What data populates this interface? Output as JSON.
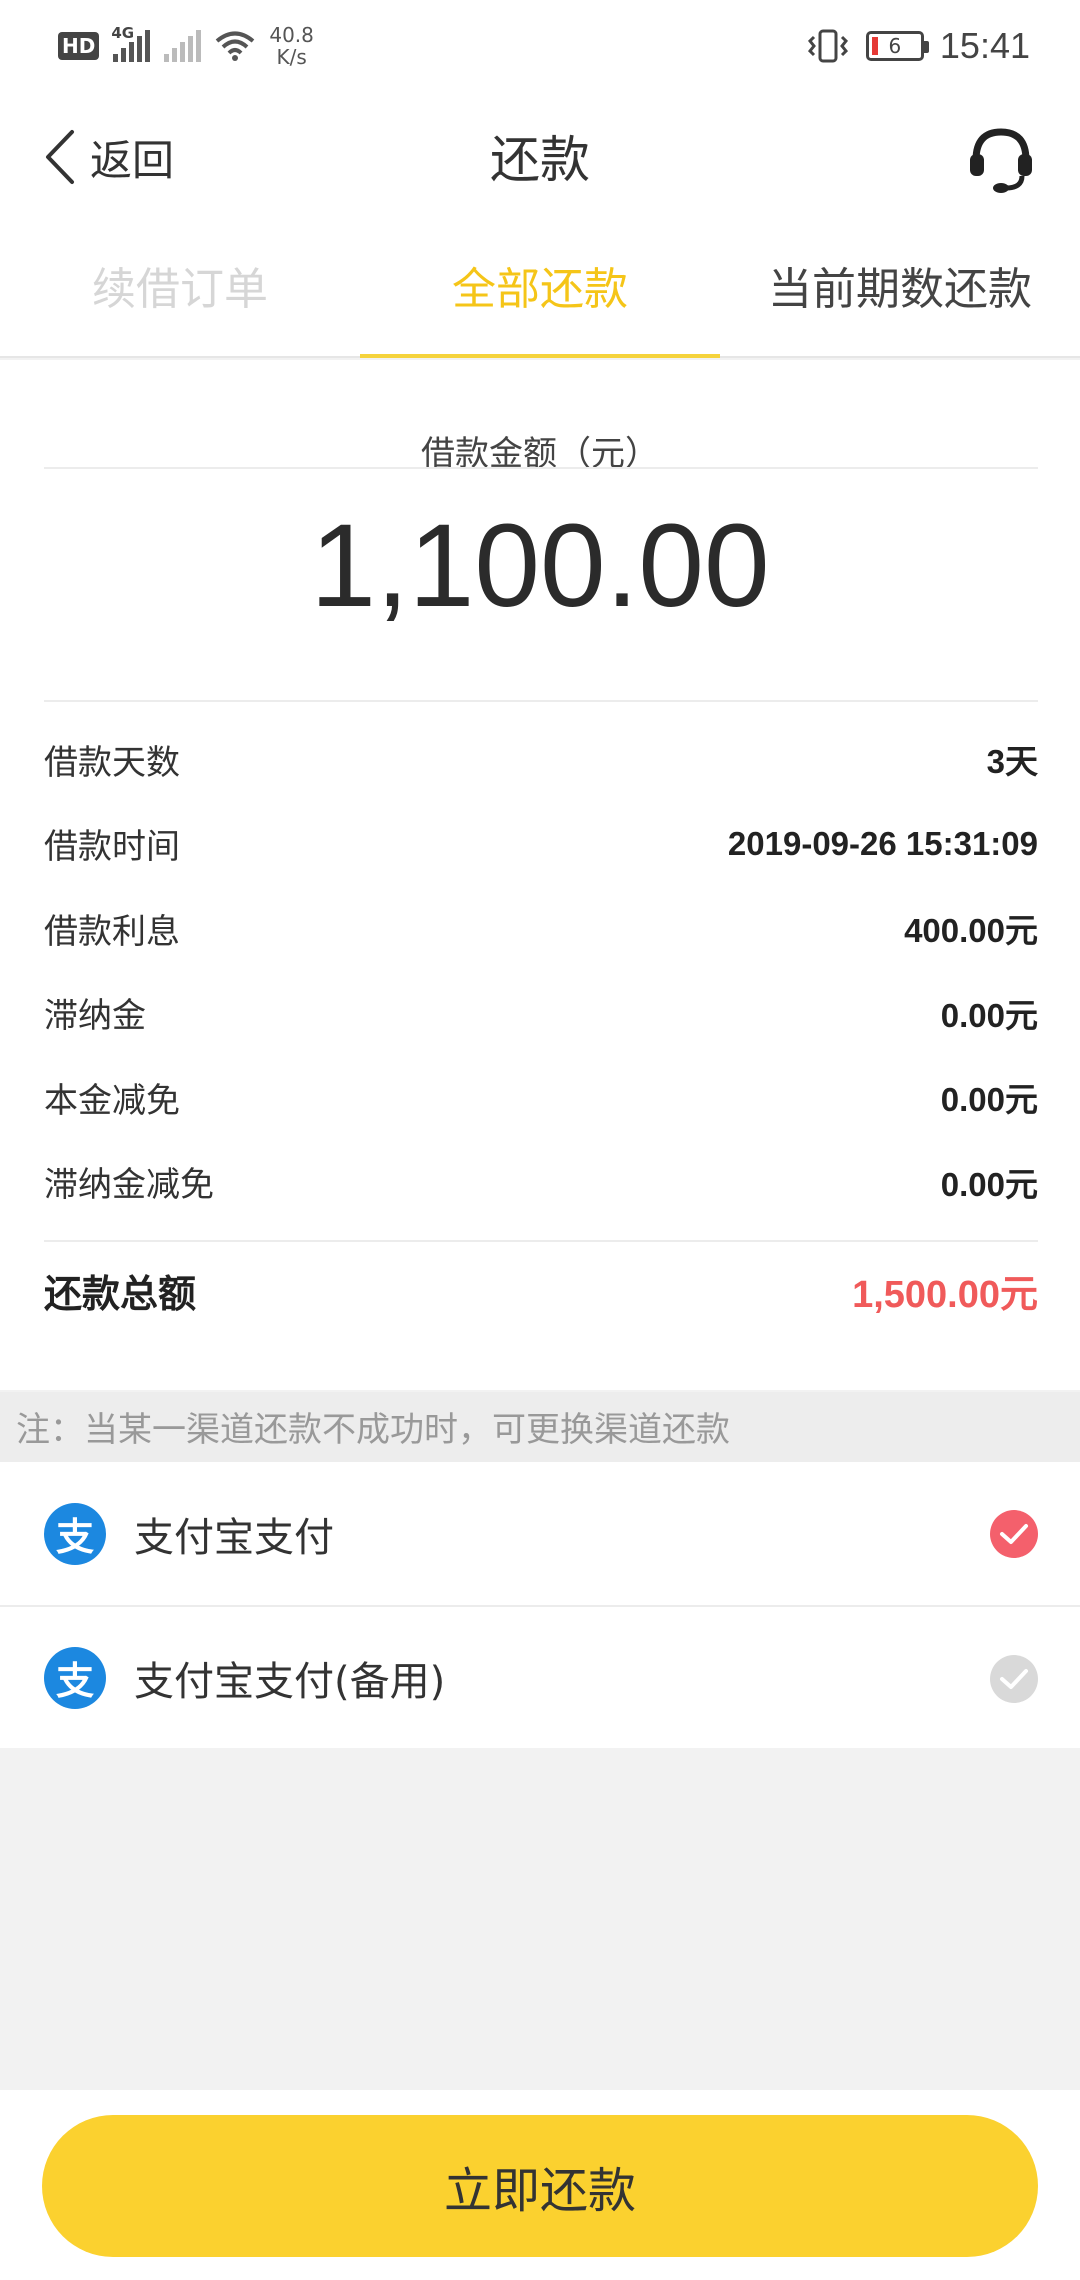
{
  "status_bar": {
    "hd": "HD",
    "network_tag": "4G",
    "speed_value": "40.8",
    "speed_unit": "K/s",
    "battery_level": "6",
    "time": "15:41"
  },
  "header": {
    "back_label": "返回",
    "title": "还款",
    "support_icon": "headset-icon"
  },
  "tabs": [
    {
      "label": "续借订单",
      "state": "disabled"
    },
    {
      "label": "全部还款",
      "state": "active"
    },
    {
      "label": "当前期数还款",
      "state": "normal"
    }
  ],
  "summary": {
    "amount_label": "借款金额（元）",
    "amount_value": "1,100.00",
    "rows": [
      {
        "label": "借款天数",
        "value": "3天"
      },
      {
        "label": "借款时间",
        "value": "2019-09-26 15:31:09"
      },
      {
        "label": "借款利息",
        "value": "400.00元"
      },
      {
        "label": "滞纳金",
        "value": "0.00元"
      },
      {
        "label": "本金减免",
        "value": "0.00元"
      },
      {
        "label": "滞纳金减免",
        "value": "0.00元"
      }
    ],
    "total_label": "还款总额",
    "total_value": "1,500.00元"
  },
  "note": "注：当某一渠道还款不成功时，可更换渠道还款",
  "payment_methods": [
    {
      "icon_text": "支",
      "label": "支付宝支付",
      "selected": true
    },
    {
      "icon_text": "支",
      "label": "支付宝支付(备用)",
      "selected": false
    }
  ],
  "submit_label": "立即还款",
  "colors": {
    "accent_yellow": "#fbd12f",
    "tab_active": "#f5c518",
    "total_red": "#f05a5a",
    "check_selected": "#f4606c",
    "alipay_blue": "#1c88e0"
  }
}
